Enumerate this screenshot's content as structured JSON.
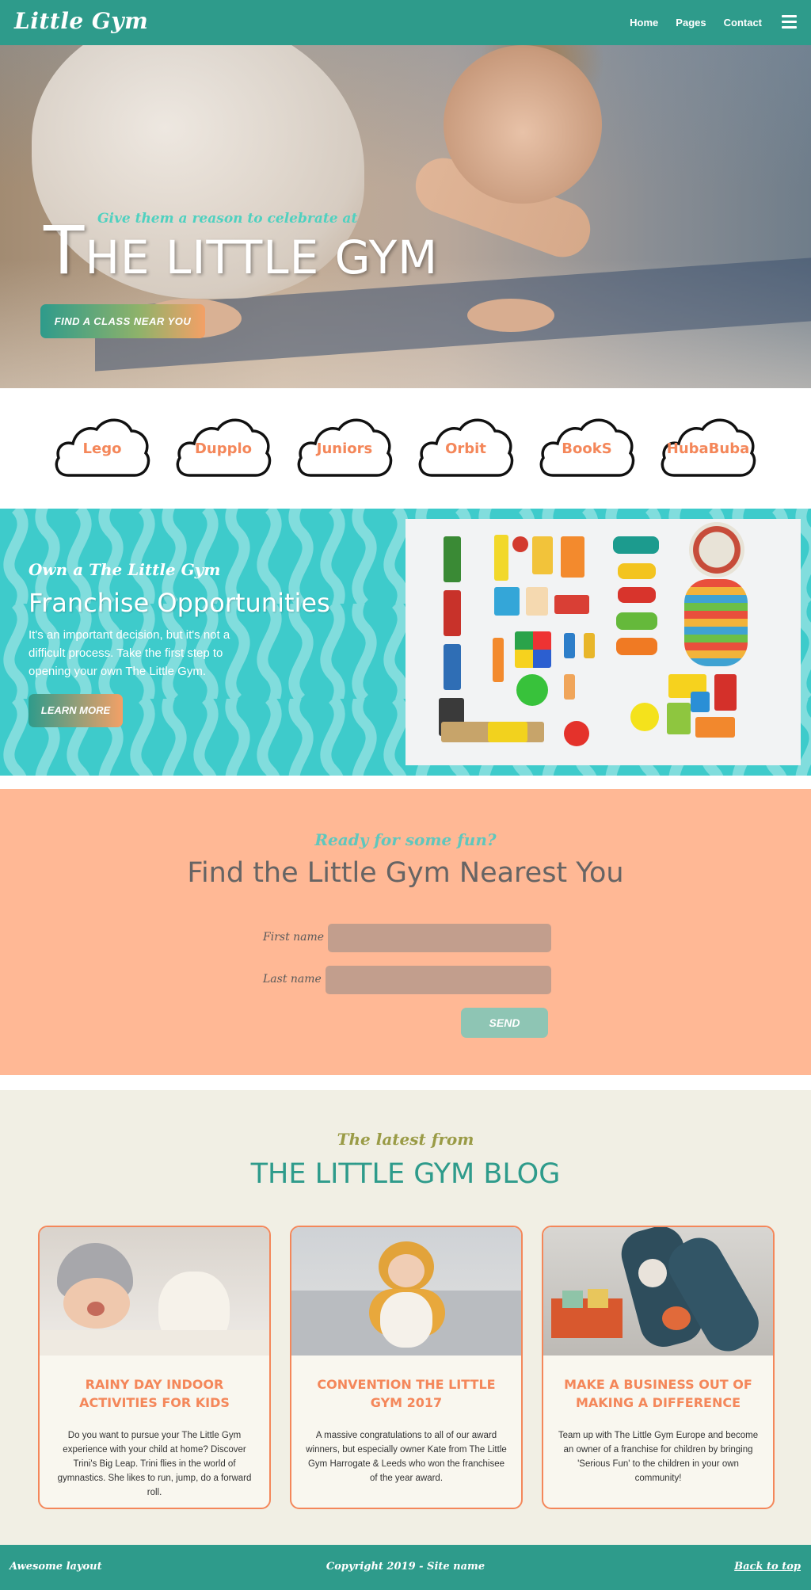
{
  "nav": {
    "logo": "Little Gym",
    "links": [
      "Home",
      "Pages",
      "Contact"
    ]
  },
  "hero": {
    "tagline": "Give them a reason to celebrate at",
    "title_first": "T",
    "title_rest": "HE LITTLE GYM",
    "button": "FIND A CLASS NEAR YOU"
  },
  "categories": [
    "Lego",
    "Dupplo",
    "Juniors",
    "Orbit",
    "BookS",
    "HubaBuba"
  ],
  "franchise": {
    "tagline": "Own a The Little Gym",
    "title": "Franchise Opportunities",
    "text": "It's an important decision, but it's not a difficult process. Take the first step to opening your own The Little Gym.",
    "button": "LEARN MORE"
  },
  "form": {
    "tagline": "Ready for some fun?",
    "title": "Find the Little Gym Nearest You",
    "first_name_label": "First name",
    "last_name_label": "Last name",
    "send": "SEND"
  },
  "blog": {
    "tagline": "The latest from",
    "title": "THE LITTLE GYM BLOG",
    "posts": [
      {
        "title": "RAINY DAY INDOOR ACTIVITIES FOR KIDS",
        "text": "Do you want to pursue your The Little Gym experience with your child at home? Discover Trini's Big Leap. Trini flies in the world of gymnastics. She likes to run, jump, do a forward roll."
      },
      {
        "title": "CONVENTION THE LITTLE GYM 2017",
        "text": "A massive congratulations to all of our award winners, but especially owner Kate from The Little Gym Harrogate & Leeds who won the franchisee of the year award."
      },
      {
        "title": "MAKE A BUSINESS OUT OF MAKING A DIFFERENCE",
        "text": "Team up with The Little Gym Europe and become an owner of a franchise for children by bringing 'Serious Fun' to the children in your own community!"
      }
    ]
  },
  "footer": {
    "left": "Awesome layout",
    "center": "Copyright 2019 - Site name",
    "right": "Back to top"
  },
  "colors": {
    "primary": "#2e9b8b",
    "accent": "#f4875a",
    "franchise_bg": "#3ecbcb",
    "form_bg": "#ffb895",
    "blog_bg": "#f1efe4"
  }
}
